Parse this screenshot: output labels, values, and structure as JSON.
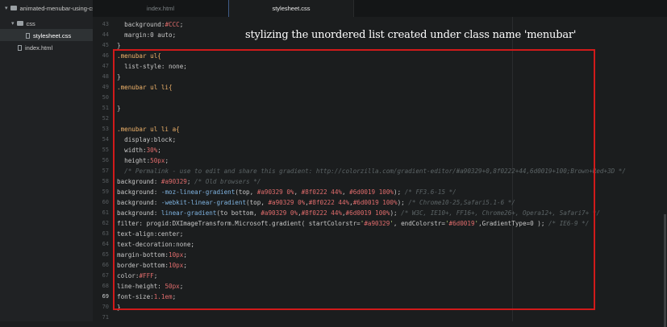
{
  "sidebar": {
    "project": "animated-menubar-using-css",
    "folder": "css",
    "file_css": "stylesheet.css",
    "file_html": "index.html"
  },
  "tabs": [
    "index.html",
    "stylesheet.css"
  ],
  "caption": "stylizing the unordered list created under class name 'menubar'",
  "lines": [
    {
      "n": "43",
      "t": "  background:#CCC;"
    },
    {
      "n": "44",
      "t": "  margin:0 auto;"
    },
    {
      "n": "45",
      "t": "}"
    },
    {
      "n": "46",
      "t": ".menubar ul{"
    },
    {
      "n": "47",
      "t": "  list-style: none;"
    },
    {
      "n": "48",
      "t": "}"
    },
    {
      "n": "49",
      "t": ".menubar ul li{"
    },
    {
      "n": "50",
      "t": ""
    },
    {
      "n": "51",
      "t": "}"
    },
    {
      "n": "52",
      "t": ""
    },
    {
      "n": "53",
      "t": ".menubar ul li a{"
    },
    {
      "n": "54",
      "t": "  display:block;"
    },
    {
      "n": "55",
      "t": "  width:30%;"
    },
    {
      "n": "56",
      "t": "  height:50px;"
    },
    {
      "n": "57",
      "t": "  /* Permalink - use to edit and share this gradient: http://colorzilla.com/gradient-editor/#a90329+0,8f0222+44,6d0019+100;Brown+Red+3D */"
    },
    {
      "n": "58",
      "t": "background: #a90329; /* Old browsers */"
    },
    {
      "n": "59",
      "t": "background: -moz-linear-gradient(top, #a90329 0%, #8f0222 44%, #6d0019 100%); /* FF3.6-15 */"
    },
    {
      "n": "60",
      "t": "background: -webkit-linear-gradient(top, #a90329 0%,#8f0222 44%,#6d0019 100%); /* Chrome10-25,Safari5.1-6 */"
    },
    {
      "n": "61",
      "t": "background: linear-gradient(to bottom, #a90329 0%,#8f0222 44%,#6d0019 100%); /* W3C, IE10+, FF16+, Chrome26+, Opera12+, Safari7+ */"
    },
    {
      "n": "62",
      "t": "filter: progid:DXImageTransform.Microsoft.gradient( startColorstr='#a90329', endColorstr='#6d0019',GradientType=0 ); /* IE6-9 */"
    },
    {
      "n": "63",
      "t": "text-align:center;"
    },
    {
      "n": "64",
      "t": "text-decoration:none;"
    },
    {
      "n": "65",
      "t": "margin-bottom:10px;"
    },
    {
      "n": "66",
      "t": "border-bottom:10px;"
    },
    {
      "n": "67",
      "t": "color:#FFF;"
    },
    {
      "n": "68",
      "t": "line-height: 50px;"
    },
    {
      "n": "69",
      "t": "font-size:1.1em;"
    },
    {
      "n": "70",
      "t": "}"
    },
    {
      "n": "71",
      "t": ""
    }
  ],
  "current_line": "69",
  "colors": {
    "accent_red": "#d11a1a",
    "background": "#1b1d1e"
  }
}
